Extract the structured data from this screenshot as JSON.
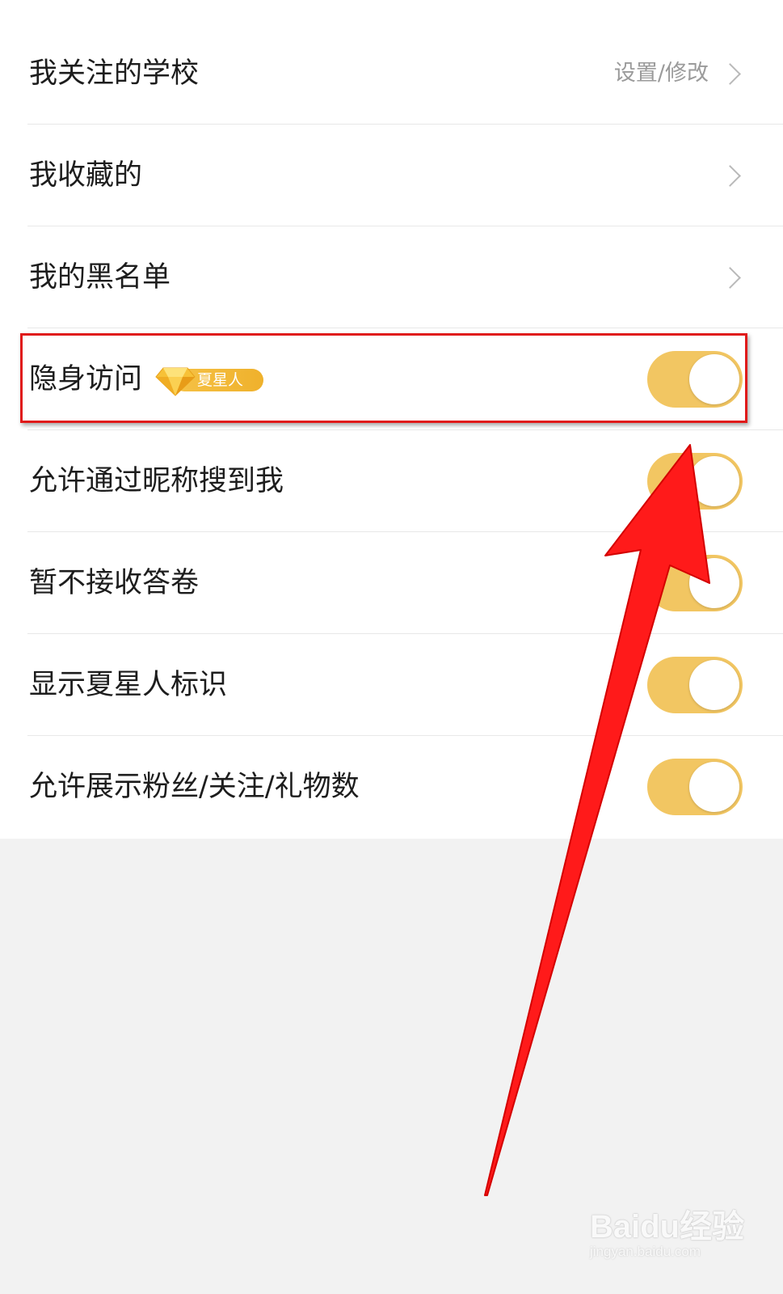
{
  "settings": {
    "followed_schools": {
      "label": "我关注的学校",
      "value": "设置/修改"
    },
    "favorites": {
      "label": "我收藏的"
    },
    "blacklist": {
      "label": "我的黑名单"
    },
    "invisible_visit": {
      "label": "隐身访问",
      "badge": "夏星人",
      "enabled": true
    },
    "search_by_nickname": {
      "label": "允许通过昵称搜到我",
      "enabled": true
    },
    "no_surveys": {
      "label": "暂不接收答卷",
      "enabled": true
    },
    "show_vip_badge": {
      "label": "显示夏星人标识",
      "enabled": true
    },
    "show_counts": {
      "label": "允许展示粉丝/关注/礼物数",
      "enabled": true
    }
  },
  "colors": {
    "toggle_on": "#f2c662",
    "annotation": "#ff1a1a",
    "page_background": "#f2f2f2"
  },
  "watermark": {
    "brand": "Baidu经验",
    "url": "jingyan.baidu.com"
  }
}
